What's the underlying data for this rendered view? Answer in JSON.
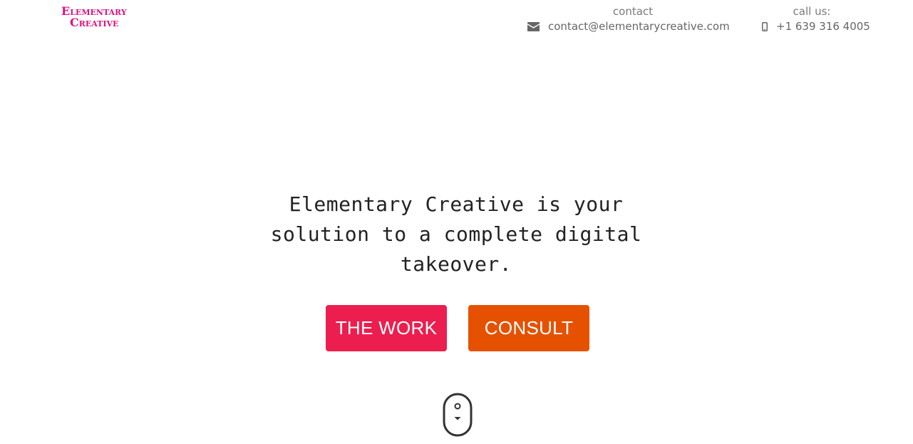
{
  "brand": {
    "line1": "Elementary",
    "line2": "Creative",
    "color": "#e0107e"
  },
  "header": {
    "contact": {
      "caption": "contact",
      "email": "contact@elementarycreative.com",
      "icon": "envelope-icon"
    },
    "phone": {
      "caption": "call us:",
      "number": "+1 639 316 4005",
      "icon": "mobile-phone-icon"
    }
  },
  "hero": {
    "headline": "Elementary Creative is your solution to a complete digital takeover.",
    "buttons": [
      {
        "label": "THE WORK",
        "color": "#ec1e4f"
      },
      {
        "label": "CONSULT",
        "color": "#e65100"
      }
    ],
    "scroll_indicator": "scroll-mouse-icon"
  }
}
